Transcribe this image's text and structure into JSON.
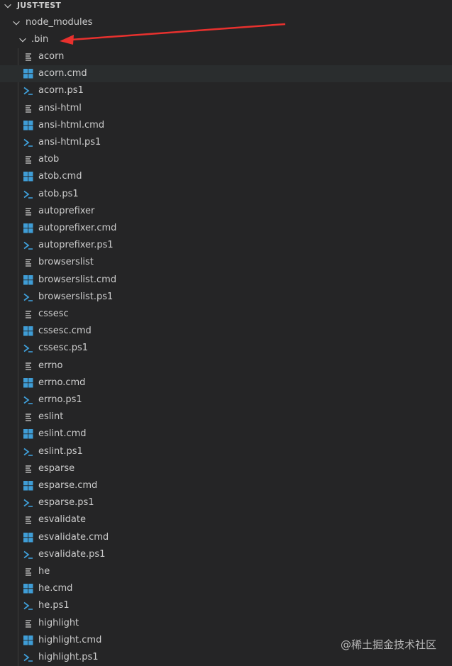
{
  "explorer": {
    "root_label": "JUST-TEST",
    "folder_node_modules": "node_modules",
    "folder_bin": ".bin",
    "files": [
      {
        "name": "acorn",
        "type": "file"
      },
      {
        "name": "acorn.cmd",
        "type": "cmd"
      },
      {
        "name": "acorn.ps1",
        "type": "ps1"
      },
      {
        "name": "ansi-html",
        "type": "file"
      },
      {
        "name": "ansi-html.cmd",
        "type": "cmd"
      },
      {
        "name": "ansi-html.ps1",
        "type": "ps1"
      },
      {
        "name": "atob",
        "type": "file"
      },
      {
        "name": "atob.cmd",
        "type": "cmd"
      },
      {
        "name": "atob.ps1",
        "type": "ps1"
      },
      {
        "name": "autoprefixer",
        "type": "file"
      },
      {
        "name": "autoprefixer.cmd",
        "type": "cmd"
      },
      {
        "name": "autoprefixer.ps1",
        "type": "ps1"
      },
      {
        "name": "browserslist",
        "type": "file"
      },
      {
        "name": "browserslist.cmd",
        "type": "cmd"
      },
      {
        "name": "browserslist.ps1",
        "type": "ps1"
      },
      {
        "name": "cssesc",
        "type": "file"
      },
      {
        "name": "cssesc.cmd",
        "type": "cmd"
      },
      {
        "name": "cssesc.ps1",
        "type": "ps1"
      },
      {
        "name": "errno",
        "type": "file"
      },
      {
        "name": "errno.cmd",
        "type": "cmd"
      },
      {
        "name": "errno.ps1",
        "type": "ps1"
      },
      {
        "name": "eslint",
        "type": "file"
      },
      {
        "name": "eslint.cmd",
        "type": "cmd"
      },
      {
        "name": "eslint.ps1",
        "type": "ps1"
      },
      {
        "name": "esparse",
        "type": "file"
      },
      {
        "name": "esparse.cmd",
        "type": "cmd"
      },
      {
        "name": "esparse.ps1",
        "type": "ps1"
      },
      {
        "name": "esvalidate",
        "type": "file"
      },
      {
        "name": "esvalidate.cmd",
        "type": "cmd"
      },
      {
        "name": "esvalidate.ps1",
        "type": "ps1"
      },
      {
        "name": "he",
        "type": "file"
      },
      {
        "name": "he.cmd",
        "type": "cmd"
      },
      {
        "name": "he.ps1",
        "type": "ps1"
      },
      {
        "name": "highlight",
        "type": "file"
      },
      {
        "name": "highlight.cmd",
        "type": "cmd"
      },
      {
        "name": "highlight.ps1",
        "type": "ps1"
      }
    ],
    "selected_file": "acorn.cmd"
  },
  "watermark": "@稀土掘金技术社区",
  "colors": {
    "background": "#252526",
    "text": "#cccccc",
    "selection": "#2a2d2e",
    "cmd_icon": "#3f9dd6",
    "ps1_icon": "#3f9dd6",
    "file_icon": "#cccccc",
    "annotation_arrow": "#e8312e"
  }
}
